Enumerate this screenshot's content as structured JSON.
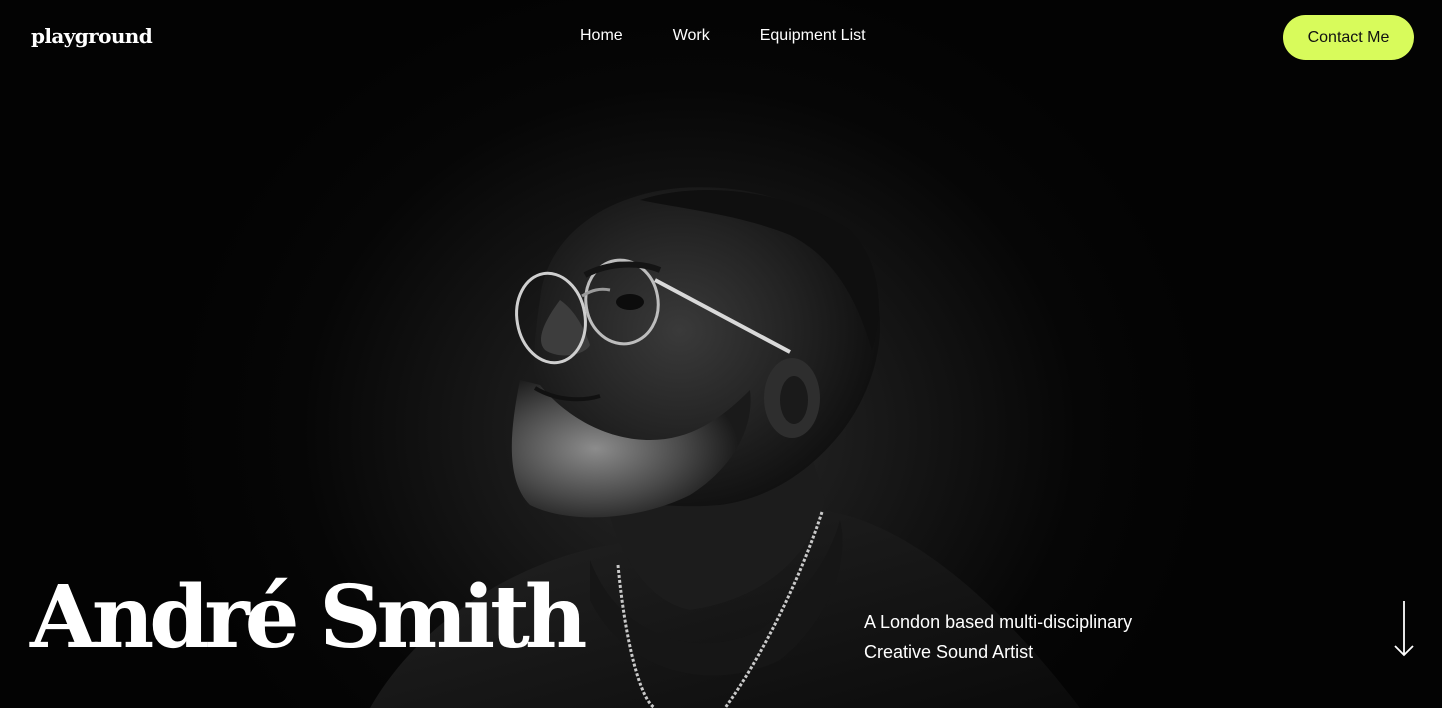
{
  "header": {
    "logo": "playground",
    "nav": [
      "Home",
      "Work",
      "Equipment List"
    ],
    "contact_label": "Contact Me"
  },
  "hero": {
    "name": "André Smith",
    "tagline_line1": "A London based multi-disciplinary",
    "tagline_line2": "Creative Sound Artist",
    "scroll_icon": "arrow-down-icon"
  },
  "colors": {
    "background": "#050505",
    "accent": "#d8fb5b",
    "text": "#ffffff"
  }
}
